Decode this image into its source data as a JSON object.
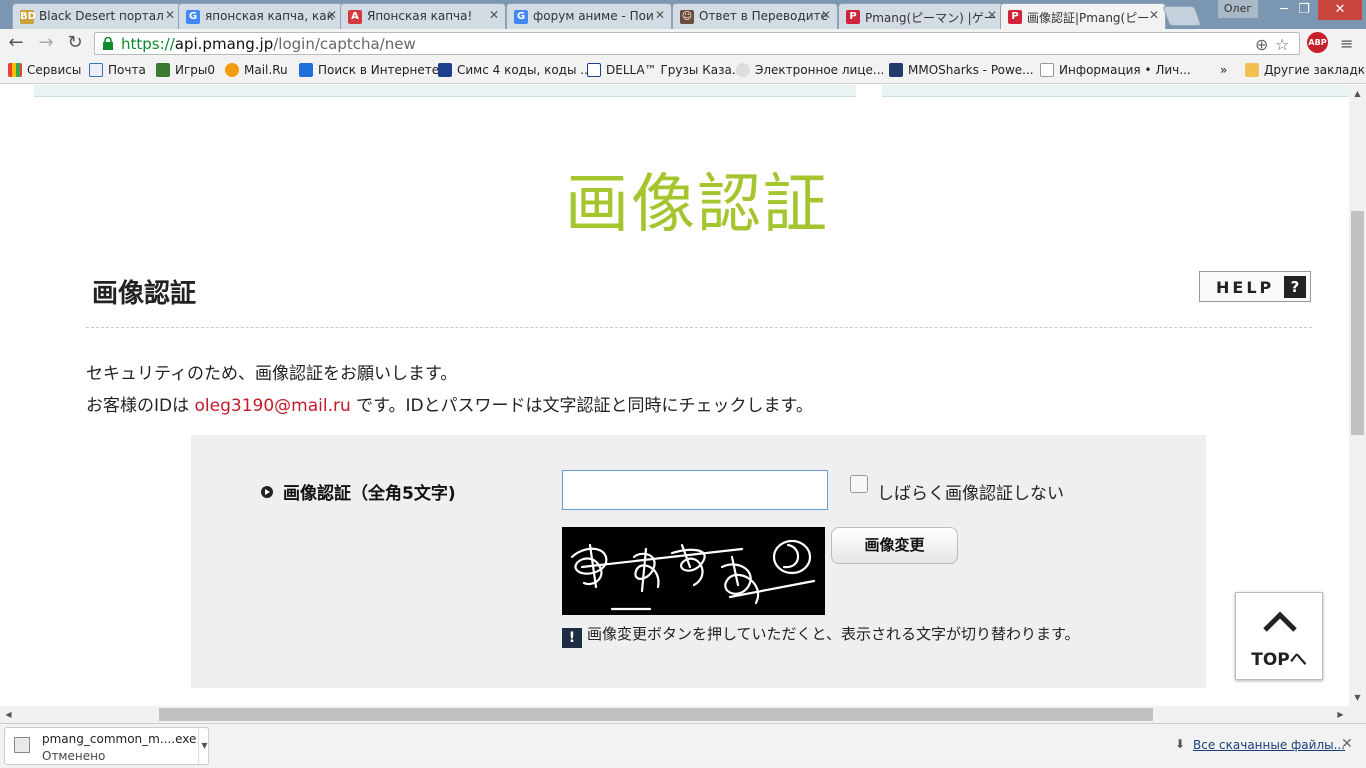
{
  "browser": {
    "tabs": [
      {
        "title": "Black Desert портал",
        "favicon": "BD",
        "favicon_color": "#c9a33a"
      },
      {
        "title": "японская капча, как",
        "favicon": "G",
        "favicon_color": "#4285f4"
      },
      {
        "title": "Японская капча!",
        "favicon": "A",
        "favicon_color": "#d23b3b"
      },
      {
        "title": "форум аниме - Пои",
        "favicon": "G",
        "favicon_color": "#4285f4"
      },
      {
        "title": "Ответ в Переводите",
        "favicon": "☺",
        "favicon_color": "#6b4c3b"
      },
      {
        "title": "Pmang(ピーマン) |ゲー",
        "favicon": "P",
        "favicon_color": "#d0243b"
      },
      {
        "title": "画像認証|Pmang(ピー",
        "favicon": "P",
        "favicon_color": "#d0243b"
      }
    ],
    "profile_name": "Олег",
    "url": {
      "scheme": "https://",
      "host": "api.pmang.jp",
      "path": "/login/captcha/new"
    },
    "bookmarks": [
      {
        "label": "Сервисы",
        "icon": "apps-grid-icon"
      },
      {
        "label": "Почта",
        "icon": "mail-icon"
      },
      {
        "label": "Игры0",
        "icon": "cube-icon"
      },
      {
        "label": "Mail.Ru",
        "icon": "at-icon"
      },
      {
        "label": "Поиск в Интернете",
        "icon": "search-icon"
      },
      {
        "label": "Симс 4 коды, коды ...",
        "icon": "plumbob-icon"
      },
      {
        "label": "DELLA™ Грузы Каза...",
        "icon": "della-icon"
      },
      {
        "label": "Электронное лице...",
        "icon": "edu-icon"
      },
      {
        "label": "MMOSharks - Powe...",
        "icon": "shark-icon"
      },
      {
        "label": "Информация • Лич...",
        "icon": "page-icon"
      }
    ],
    "bookmarks_overflow": "»",
    "other_bookmarks": "Другие закладки",
    "abp_label": "ABP"
  },
  "page": {
    "hero_title": "画像認証",
    "title": "画像認証",
    "help_label": "HELP",
    "help_q": "?",
    "message_line1": "セキュリティのため、画像認証をお願いします。",
    "message_line2_prefix": "お客様のIDは",
    "email": "oleg3190@mail.ru",
    "message_line2_suffix": "です。IDとパスワードは文字認証と同時にチェックします。",
    "form": {
      "label": "画像認証（全角5文字)",
      "input_value": "",
      "skip_label": "しばらく画像認証しない",
      "refresh_label": "画像変更",
      "note_mark": "!",
      "note": "画像変更ボタンを押していただくと、表示される文字が切り替わります。"
    },
    "top_label": "TOPへ"
  },
  "downloads": {
    "item_name": "pmang_common_m....exe",
    "item_status": "Отменено",
    "show_all": "Все скачанные файлы..."
  }
}
